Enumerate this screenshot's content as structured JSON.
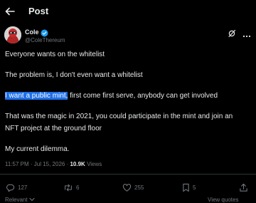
{
  "header": {
    "title": "Post"
  },
  "author": {
    "name": "Cole",
    "handle": "@ColeThereum"
  },
  "post": {
    "line1": "Everyone wants on the whitelist",
    "line2": "The problem is, I don't even want a whitelist",
    "line3_highlight": "I want a public mint,",
    "line3_rest": " first come first serve, anybody can get involved",
    "line4a": "That was the magic in 2021, you could participate in the mint and join an",
    "line4b": "NFT project at the ground floor",
    "line5": "My current dilemma."
  },
  "meta": {
    "time": "11:57 PM",
    "date": "Jul 15, 2026",
    "views_count": "10.9K",
    "views_label": "Views"
  },
  "actions": {
    "replies": "127",
    "reposts": "6",
    "likes": "255",
    "bookmarks": "5"
  },
  "footer": {
    "left": "Relevant",
    "right": "View quotes"
  },
  "colors": {
    "background": "#000000",
    "text": "#e7e9ea",
    "muted": "#71767b",
    "accent": "#1d9bf0",
    "highlight": "#1d6fe8"
  },
  "icons": [
    "back-arrow-icon",
    "verified-badge-icon",
    "grok-icon",
    "more-icon",
    "reply-icon",
    "repost-icon",
    "like-icon",
    "bookmark-icon",
    "share-icon",
    "chevron-down-icon"
  ]
}
